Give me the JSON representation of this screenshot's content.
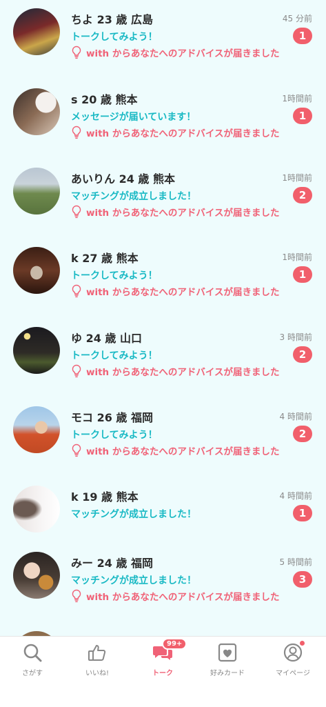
{
  "conversations": [
    {
      "name": "ちよ 23 歳 広島",
      "time": "45 分前",
      "message": "トークしてみよう！",
      "advice": "with からあなたへのアドバイスが届きました",
      "badge": "1"
    },
    {
      "name": "s 20 歳 熊本",
      "time": "1時間前",
      "message": "メッセージが届いています！",
      "advice": "with からあなたへのアドバイスが届きました",
      "badge": "1"
    },
    {
      "name": "あいりん 24 歳 熊本",
      "time": "1時間前",
      "message": "マッチングが成立しました！",
      "advice": "with からあなたへのアドバイスが届きました",
      "badge": "2"
    },
    {
      "name": "k 27 歳 熊本",
      "time": "1時間前",
      "message": "トークしてみよう！",
      "advice": "with からあなたへのアドバイスが届きました",
      "badge": "1"
    },
    {
      "name": "ゆ 24 歳 山口",
      "time": "3 時間前",
      "message": "トークしてみよう！",
      "advice": "with からあなたへのアドバイスが届きました",
      "badge": "2"
    },
    {
      "name": "モコ 26 歳 福岡",
      "time": "4 時間前",
      "message": "トークしてみよう！",
      "advice": "with からあなたへのアドバイスが届きました",
      "badge": "2"
    },
    {
      "name": "k  19 歳 熊本",
      "time": "4 時間前",
      "message": "マッチングが成立しました！",
      "advice": "",
      "badge": "1"
    },
    {
      "name": "みー 24 歳 福岡",
      "time": "5 時間前",
      "message": "マッチングが成立しました！",
      "advice": "with からあなたへのアドバイスが届きました",
      "badge": "3"
    }
  ],
  "tabbar": {
    "search": "さがす",
    "likes": "いいね!",
    "talk": "トーク",
    "talk_badge": "99+",
    "cards": "好みカード",
    "mypage": "マイページ"
  },
  "colors": {
    "accent": "#f06277",
    "teal": "#19b9c4",
    "badge": "#f15f6b",
    "list_bg": "#eefcfd"
  }
}
